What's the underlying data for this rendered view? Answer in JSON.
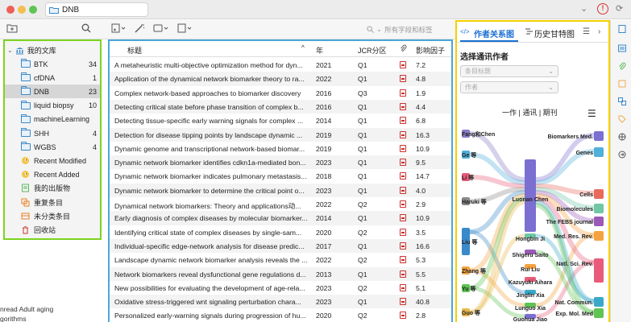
{
  "window": {
    "tab_label": "DNB"
  },
  "toolbar": {
    "search_placeholder": "所有字段和标签"
  },
  "library": {
    "root": "我的文库",
    "folders": [
      {
        "name": "BTK",
        "count": "34"
      },
      {
        "name": "cfDNA",
        "count": "1"
      },
      {
        "name": "DNB",
        "count": "23"
      },
      {
        "name": "liquid biopsy",
        "count": "10"
      },
      {
        "name": "machineLearning",
        "count": ""
      },
      {
        "name": "SHH",
        "count": "4"
      },
      {
        "name": "WGBS",
        "count": "4"
      }
    ],
    "special": [
      {
        "name": "Recent Modified",
        "icon": "clock-icon"
      },
      {
        "name": "Recent Added",
        "icon": "clock-icon"
      },
      {
        "name": "我的出版物",
        "icon": "publication-icon"
      },
      {
        "name": "重复条目",
        "icon": "duplicate-icon"
      },
      {
        "name": "未分类条目",
        "icon": "unfiled-icon"
      },
      {
        "name": "回收站",
        "icon": "trash-icon"
      }
    ]
  },
  "tags": {
    "line1": "nread  Adult  aging",
    "line2": "gorithms"
  },
  "table": {
    "headers": {
      "title": "标题",
      "year": "年",
      "jcr": "JCR分区",
      "if": "影响因子"
    },
    "rows": [
      {
        "title": "A metaheuristic multi-objective optimization method for dyn...",
        "year": "2021",
        "q": "Q1",
        "if": "7.2"
      },
      {
        "title": "Application of the dynamical network biomarker theory to ra...",
        "year": "2022",
        "q": "Q1",
        "if": "4.8"
      },
      {
        "title": "Complex network-based approaches to biomarker discovery",
        "year": "2016",
        "q": "Q3",
        "if": "1.9"
      },
      {
        "title": "Detecting critical state before phase transition of complex b...",
        "year": "2016",
        "q": "Q1",
        "if": "4.4"
      },
      {
        "title": "Detecting tissue-specific early warning signals for complex ...",
        "year": "2014",
        "q": "Q1",
        "if": "6.8"
      },
      {
        "title": "Detection for disease tipping points by landscape dynamic ...",
        "year": "2019",
        "q": "Q1",
        "if": "16.3"
      },
      {
        "title": "Dynamic genome and transcriptional network-based biomar...",
        "year": "2019",
        "q": "Q1",
        "if": "10.9"
      },
      {
        "title": "Dynamic network biomarker identifies cdkn1a-mediated bon...",
        "year": "2023",
        "q": "Q1",
        "if": "9.5"
      },
      {
        "title": "Dynamic network biomarker indicates pulmonary metastasis...",
        "year": "2018",
        "q": "Q1",
        "if": "14.7"
      },
      {
        "title": "Dynamic network biomarker to determine the critical point o...",
        "year": "2023",
        "q": "Q1",
        "if": "4.0"
      },
      {
        "title": "Dynamical network biomarkers: Theory and applications动...",
        "year": "2022",
        "q": "Q2",
        "if": "2.9"
      },
      {
        "title": "Early diagnosis of complex diseases by molecular biomarker...",
        "year": "2014",
        "q": "Q1",
        "if": "10.9"
      },
      {
        "title": "Identifying critical state of complex diseases by single-sam...",
        "year": "2020",
        "q": "Q2",
        "if": "3.5"
      },
      {
        "title": "Individual-specific edge-network analysis for disease predic...",
        "year": "2017",
        "q": "Q1",
        "if": "16.6"
      },
      {
        "title": "Landscape dynamic network biomarker analysis reveals the ...",
        "year": "2022",
        "q": "Q2",
        "if": "5.3"
      },
      {
        "title": "Network biomarkers reveal dysfunctional gene regulations d...",
        "year": "2013",
        "q": "Q1",
        "if": "5.5"
      },
      {
        "title": "New possibilities for evaluating the development of age-rela...",
        "year": "2023",
        "q": "Q2",
        "if": "5.1"
      },
      {
        "title": "Oxidative stress-triggered wnt signaling perturbation chara...",
        "year": "2023",
        "q": "Q1",
        "if": "40.8"
      },
      {
        "title": "Personalized early-warning signals during progression of hu...",
        "year": "2020",
        "q": "Q2",
        "if": "2.8"
      }
    ]
  },
  "right_panel": {
    "tabs": [
      "作者关系图",
      "历史甘特图"
    ],
    "heading": "选择通讯作者",
    "dropdown1": "条目标题",
    "dropdown2": "作者",
    "subheading": "一作 | 通讯 | 期刊",
    "sankey": {
      "left": [
        "Fang和Chen",
        "Ge 等",
        "Li 等",
        "Haruki 等",
        "Liu 等",
        "Zhang 等",
        "Yu 等",
        "Guo 等"
      ],
      "middle": [
        "Luonan Chen",
        "Hongbin Ji",
        "Shigeru Saito",
        "Rui Liu",
        "Kazuyuki Aihara",
        "Jinglin Xia",
        "Lunguo Xia",
        "Guohua Jiao"
      ],
      "right": [
        "Biomarkers Med.",
        "Genes",
        "Cells",
        "Biomolecules",
        "The FEBS journal",
        "Med. Res. Rev.",
        "Natl. Sci. Rev.",
        "Nat. Commun.",
        "Exp. Mol. Med"
      ]
    }
  },
  "colors": {
    "left_highlight": "#7ed321",
    "table_highlight": "#4aa8d8",
    "right_highlight": "#f5d000",
    "accent": "#1a6fd1"
  }
}
